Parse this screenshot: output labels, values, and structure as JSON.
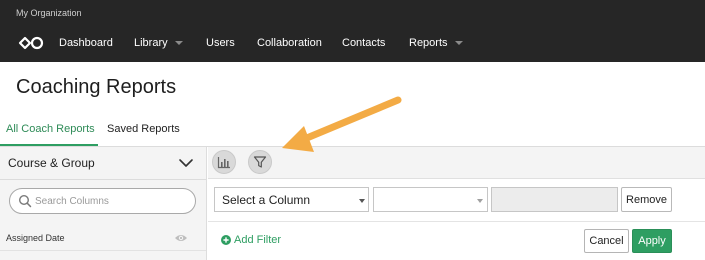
{
  "org": {
    "name": "My Organization"
  },
  "nav": {
    "items": [
      {
        "label": "Dashboard",
        "has_dropdown": false
      },
      {
        "label": "Library",
        "has_dropdown": true
      },
      {
        "label": "Users",
        "has_dropdown": false
      },
      {
        "label": "Collaboration",
        "has_dropdown": false
      },
      {
        "label": "Contacts",
        "has_dropdown": false
      },
      {
        "label": "Reports",
        "has_dropdown": true
      }
    ]
  },
  "page": {
    "title": "Coaching Reports"
  },
  "tabs": [
    {
      "label": "All Coach Reports",
      "active": true
    },
    {
      "label": "Saved Reports",
      "active": false
    }
  ],
  "sidebar": {
    "section_title": "Course & Group",
    "search_placeholder": "Search Columns",
    "columns": [
      {
        "label": "Assigned Date",
        "icon": "eye-icon"
      }
    ]
  },
  "toolbar": {
    "buttons": [
      {
        "icon": "bar-chart-icon"
      },
      {
        "icon": "filter-icon"
      }
    ]
  },
  "filter": {
    "column_select": {
      "value": "Select a Column"
    },
    "operator_select": {
      "value": ""
    },
    "value_input": {
      "value": ""
    },
    "remove_label": "Remove",
    "add_filter_label": "Add Filter",
    "cancel_label": "Cancel",
    "apply_label": "Apply"
  },
  "colors": {
    "topbar": "#262626",
    "accent": "#2e9e62",
    "annotation_arrow": "#f3ab45"
  }
}
